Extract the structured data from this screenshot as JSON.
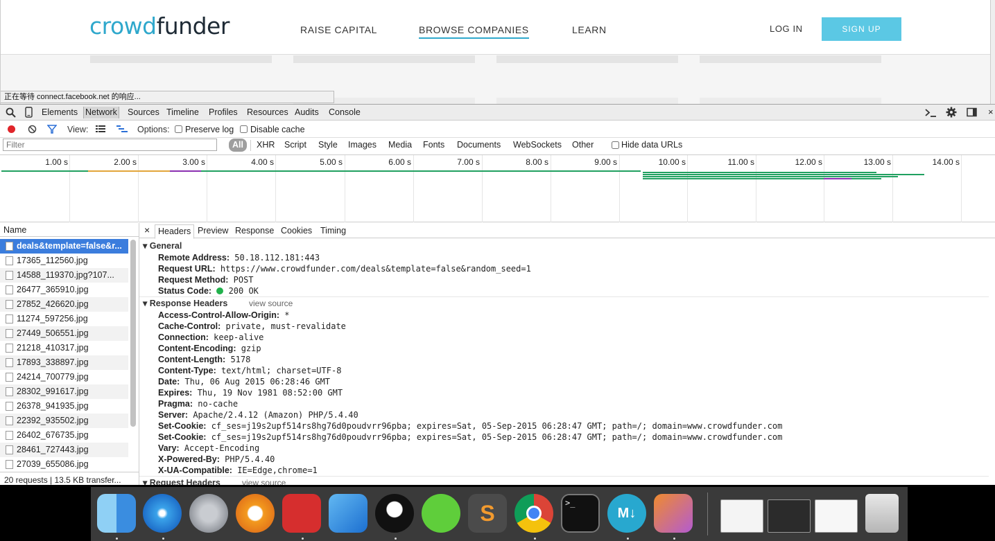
{
  "site": {
    "logo_part1": "crowd",
    "logo_part2": "funder",
    "nav": [
      "RAISE CAPITAL",
      "BROWSE COMPANIES",
      "LEARN"
    ],
    "login": "LOG IN",
    "signup": "SIGN UP",
    "status_text": "正在等待 connect.facebook.net 的响应..."
  },
  "devtools": {
    "tabs": [
      "Elements",
      "Network",
      "Sources",
      "Timeline",
      "Profiles",
      "Resources",
      "Audits",
      "Console"
    ],
    "toolbar": {
      "view_label": "View:",
      "options_label": "Options:",
      "preserve_log": "Preserve log",
      "disable_cache": "Disable cache"
    },
    "filter": {
      "placeholder": "Filter",
      "types": [
        "All",
        "XHR",
        "Script",
        "Style",
        "Images",
        "Media",
        "Fonts",
        "Documents",
        "WebSockets",
        "Other"
      ],
      "hide_data_urls": "Hide data URLs"
    },
    "timeline_ticks": [
      "1.00 s",
      "2.00 s",
      "3.00 s",
      "4.00 s",
      "5.00 s",
      "6.00 s",
      "7.00 s",
      "8.00 s",
      "9.00 s",
      "10.00 s",
      "11.00 s",
      "12.00 s",
      "13.00 s",
      "14.00 s"
    ],
    "name_header": "Name",
    "requests": [
      "deals&template=false&r...",
      "17365_112560.jpg",
      "14588_119370.jpg?107...",
      "26477_365910.jpg",
      "27852_426620.jpg",
      "11274_597256.jpg",
      "27449_506551.jpg",
      "21218_410317.jpg",
      "17893_338897.jpg",
      "24214_700779.jpg",
      "28302_991617.jpg",
      "26378_941935.jpg",
      "22392_935502.jpg",
      "26402_676735.jpg",
      "28461_727443.jpg",
      "27039_655086.jpg"
    ],
    "summary": "20 requests | 13.5 KB transfer...",
    "detail_tabs": [
      "Headers",
      "Preview",
      "Response",
      "Cookies",
      "Timing"
    ],
    "close_symbol": "×",
    "general": {
      "title": "General",
      "rows": [
        [
          "Remote Address:",
          "50.18.112.181:443"
        ],
        [
          "Request URL:",
          "https://www.crowdfunder.com/deals&template=false&random_seed=1"
        ],
        [
          "Request Method:",
          "POST"
        ],
        [
          "Status Code:",
          "200 OK"
        ]
      ]
    },
    "response_headers": {
      "title": "Response Headers",
      "view_source": "view source",
      "rows": [
        [
          "Access-Control-Allow-Origin:",
          "*"
        ],
        [
          "Cache-Control:",
          "private, must-revalidate"
        ],
        [
          "Connection:",
          "keep-alive"
        ],
        [
          "Content-Encoding:",
          "gzip"
        ],
        [
          "Content-Length:",
          "5178"
        ],
        [
          "Content-Type:",
          "text/html; charset=UTF-8"
        ],
        [
          "Date:",
          "Thu, 06 Aug 2015 06:28:46 GMT"
        ],
        [
          "Expires:",
          "Thu, 19 Nov 1981 08:52:00 GMT"
        ],
        [
          "Pragma:",
          "no-cache"
        ],
        [
          "Server:",
          "Apache/2.4.12 (Amazon) PHP/5.4.40"
        ],
        [
          "Set-Cookie:",
          "cf_ses=j19s2upf514rs8hg76d0poudvrr96pba; expires=Sat, 05-Sep-2015 06:28:47 GMT; path=/; domain=www.crowdfunder.com"
        ],
        [
          "Set-Cookie:",
          "cf_ses=j19s2upf514rs8hg76d0poudvrr96pba; expires=Sat, 05-Sep-2015 06:28:47 GMT; path=/; domain=www.crowdfunder.com"
        ],
        [
          "Vary:",
          "Accept-Encoding"
        ],
        [
          "X-Powered-By:",
          "PHP/5.4.40"
        ],
        [
          "X-UA-Compatible:",
          "IE=Edge,chrome=1"
        ]
      ]
    },
    "request_headers": {
      "title": "Request Headers",
      "view_source": "view source"
    }
  },
  "dock": {
    "apps": [
      "finder-icon",
      "safari-icon",
      "launchpad-icon",
      "ibooks-icon",
      "netease-music-icon",
      "xcode-icon",
      "qq-icon",
      "wechat-icon",
      "sublime-text-icon",
      "chrome-icon",
      "terminal-icon",
      "markdown-icon",
      "phpstorm-icon"
    ],
    "terminal_glyph": ">_",
    "markdown_glyph": "M↓",
    "sublime_glyph": "S"
  }
}
